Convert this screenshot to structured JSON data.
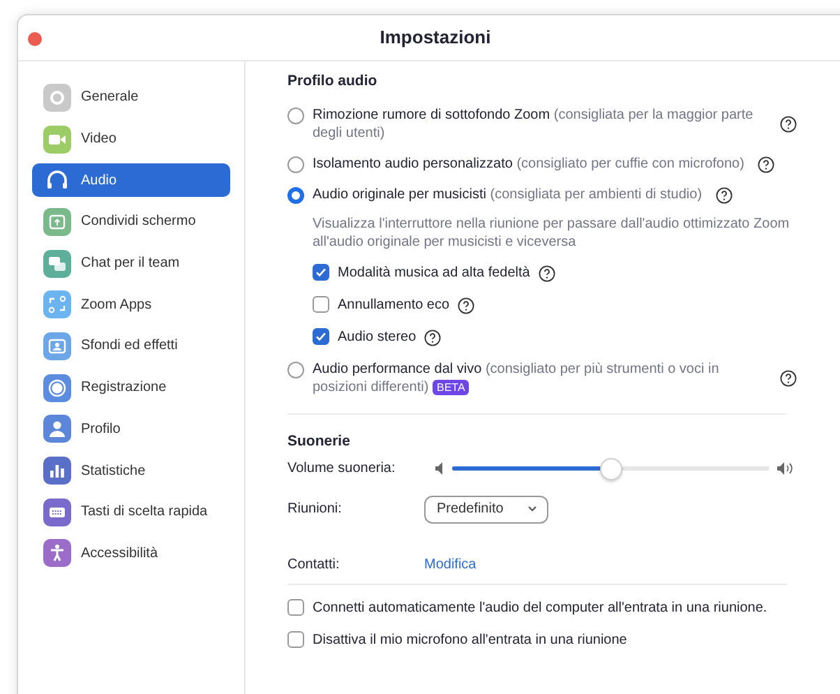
{
  "window": {
    "title": "Impostazioni"
  },
  "sidebar": {
    "items": [
      {
        "label": "Generale",
        "selected": false
      },
      {
        "label": "Video",
        "selected": false
      },
      {
        "label": "Audio",
        "selected": true
      },
      {
        "label": "Condividi schermo",
        "selected": false
      },
      {
        "label": "Chat per il team",
        "selected": false
      },
      {
        "label": "Zoom Apps",
        "selected": false
      },
      {
        "label": "Sfondi ed effetti",
        "selected": false
      },
      {
        "label": "Registrazione",
        "selected": false
      },
      {
        "label": "Profilo",
        "selected": false
      },
      {
        "label": "Statistiche",
        "selected": false
      },
      {
        "label": "Tasti di scelta rapida",
        "selected": false
      },
      {
        "label": "Accessibilità",
        "selected": false
      }
    ]
  },
  "audio_profile": {
    "title": "Profilo audio",
    "options": [
      {
        "label": "Rimozione rumore di sottofondo Zoom",
        "note": "(consigliata per la maggior parte degli utenti)",
        "selected": false
      },
      {
        "label": "Isolamento audio personalizzato",
        "note": "(consigliato per cuffie con microfono)",
        "selected": false
      },
      {
        "label": "Audio originale per musicisti",
        "note": "(consigliata per ambienti di studio)",
        "selected": true,
        "description": "Visualizza l'interruttore nella riunione per passare dall'audio ottimizzato Zoom all'audio originale per musicisti e viceversa",
        "checkboxes": [
          {
            "label": "Modalità musica ad alta fedeltà",
            "checked": true
          },
          {
            "label": "Annullamento eco",
            "checked": false
          },
          {
            "label": "Audio stereo",
            "checked": true
          }
        ]
      },
      {
        "label": "Audio performance dal vivo",
        "note": "(consigliato per più strumenti o voci in posizioni differenti)",
        "badge": "BETA",
        "selected": false
      }
    ]
  },
  "ringtones": {
    "title": "Suonerie",
    "volume": {
      "label": "Volume suoneria:",
      "level": 0.5
    },
    "meetings": {
      "label": "Riunioni:",
      "value": "Predefinito"
    },
    "contacts": {
      "label": "Contatti:",
      "link": "Modifica"
    }
  },
  "checkboxes": [
    {
      "label": "Connetti automaticamente l'audio del computer all'entrata in una riunione.",
      "checked": false
    },
    {
      "label": "Disattiva il mio microfono all'entrata in una riunione",
      "checked": false
    }
  ]
}
